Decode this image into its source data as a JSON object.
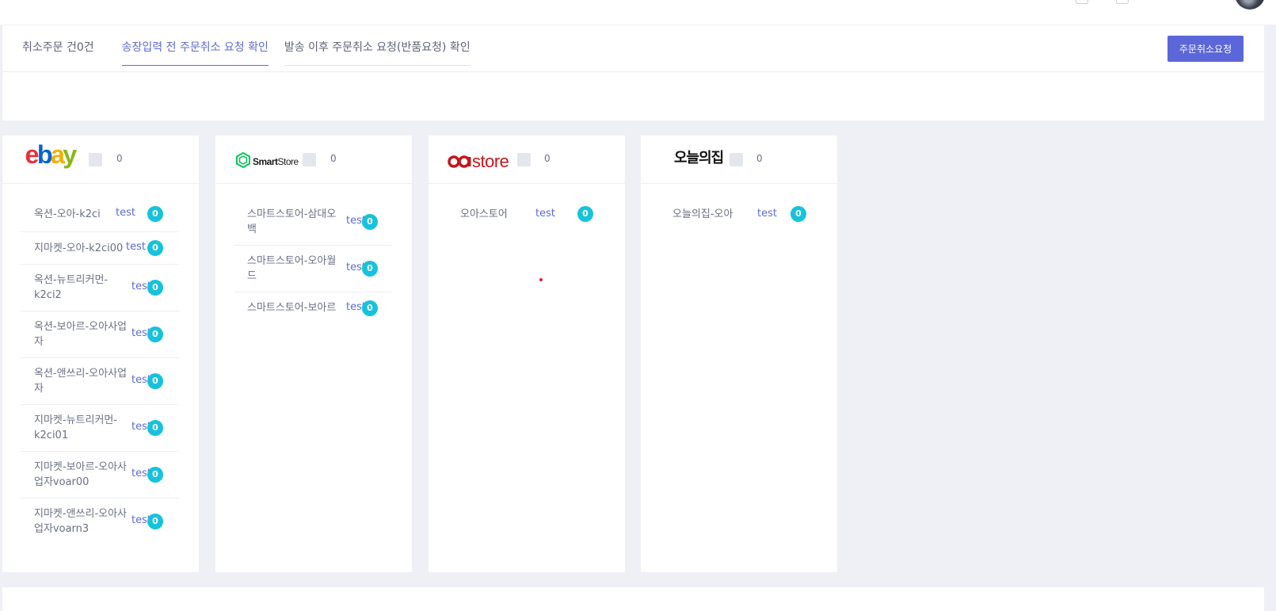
{
  "tabs": [
    {
      "label": "취소주문 건0건"
    },
    {
      "label": "송장입력 전 주문취소 요청 확인"
    },
    {
      "label": "발송 이후 주문취소 요청(반품요청) 확인"
    }
  ],
  "request_button": "주문취소요청",
  "colors": {
    "accent": "#5b67d9",
    "badge": "#16c2dc"
  },
  "cards": [
    {
      "logo": "ebay",
      "count": "0",
      "rows": [
        {
          "name": "옥션-오아-k2ci",
          "test": "test",
          "count": "0"
        },
        {
          "name": "지마켓-오아-k2ci00",
          "test": "test",
          "count": "0"
        },
        {
          "name": "옥션-뉴트리커먼-k2ci2",
          "test": "test",
          "count": "0"
        },
        {
          "name": "옥션-보아르-오아사업자",
          "test": "test",
          "count": "0"
        },
        {
          "name": "옥션-앤쓰리-오아사업자",
          "test": "test",
          "count": "0"
        },
        {
          "name": "지마켓-뉴트리커먼-k2ci01",
          "test": "test",
          "count": "0"
        },
        {
          "name": "지마켓-보아르-오아사업자voar00",
          "test": "test",
          "count": "0"
        },
        {
          "name": "지마켓-앤쓰리-오아사업자voarn3",
          "test": "test",
          "count": "0"
        }
      ]
    },
    {
      "logo": "SmartStore",
      "count": "0",
      "rows": [
        {
          "name": "스마트스토어-삼대오백",
          "test": "test",
          "count": "0"
        },
        {
          "name": "스마트스토어-오아월드",
          "test": "test",
          "count": "0"
        },
        {
          "name": "스마트스토어-보아르",
          "test": "test",
          "count": "0"
        }
      ]
    },
    {
      "logo": "store",
      "count": "0",
      "rows": [
        {
          "name": "오아스토어",
          "test": "test",
          "count": "0"
        }
      ]
    },
    {
      "logo": "오늘의집",
      "count": "0",
      "rows": [
        {
          "name": "오늘의집-오아",
          "test": "test",
          "count": "0"
        }
      ]
    }
  ]
}
